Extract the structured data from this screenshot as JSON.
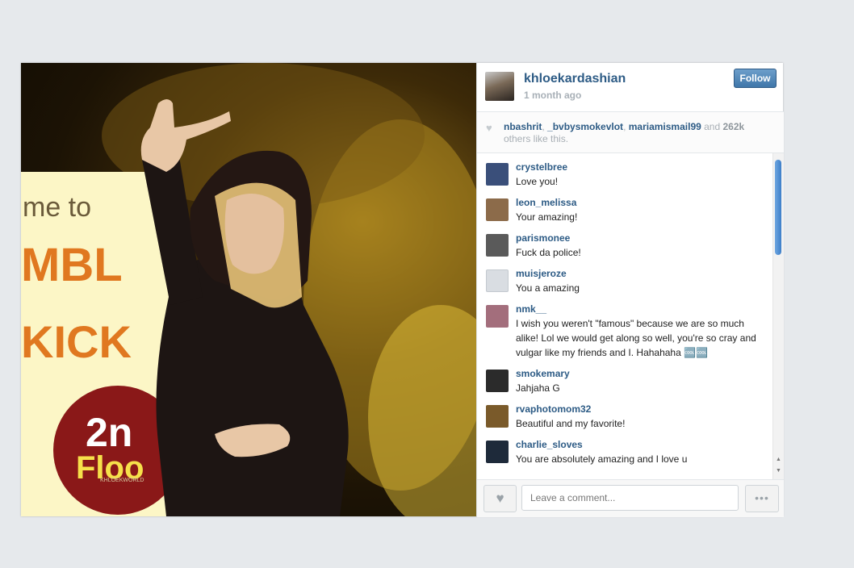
{
  "post": {
    "username": "khloekardashian",
    "time": "1 month ago",
    "follow_label": "Follow",
    "photo_watermark": "KHLOEKWORLD"
  },
  "likes": {
    "users": [
      "nbashrit",
      "_bvbysmokevlot",
      "mariamismail99"
    ],
    "sep1": ", ",
    "sep2": ", ",
    "and": " and ",
    "count": "262k",
    "rest": "others like this."
  },
  "comments": [
    {
      "user": "crystelbree",
      "text": "Love you!",
      "avatar_color": "#3a4f7a"
    },
    {
      "user": "leon_melissa",
      "text": "Your amazing!",
      "avatar_color": "#8c6b4a"
    },
    {
      "user": "parismonee",
      "text": "Fuck da police!",
      "avatar_color": "#5a5a5a"
    },
    {
      "user": "muisjeroze",
      "text": "You a amazing",
      "avatar_color": "#d9dde2"
    },
    {
      "user": "nmk__",
      "text": "I wish you weren't \"famous\" because we are so much alike! Lol we would get along so well, you're so cray and vulgar like my friends and I. Hahahaha 🆒🆒",
      "avatar_color": "#a36e7c"
    },
    {
      "user": "smokemary",
      "text": "Jahjaha G",
      "avatar_color": "#2b2b2b"
    },
    {
      "user": "rvaphotomom32",
      "text": "Beautiful and my favorite!",
      "avatar_color": "#7a5a2a"
    },
    {
      "user": "charlie_sloves",
      "text": "You are absolutely amazing and I love u",
      "avatar_color": "#1e2a3a"
    }
  ],
  "footer": {
    "comment_placeholder": "Leave a comment...",
    "like_icon": "heart-icon",
    "more_icon": "ellipsis-icon"
  }
}
